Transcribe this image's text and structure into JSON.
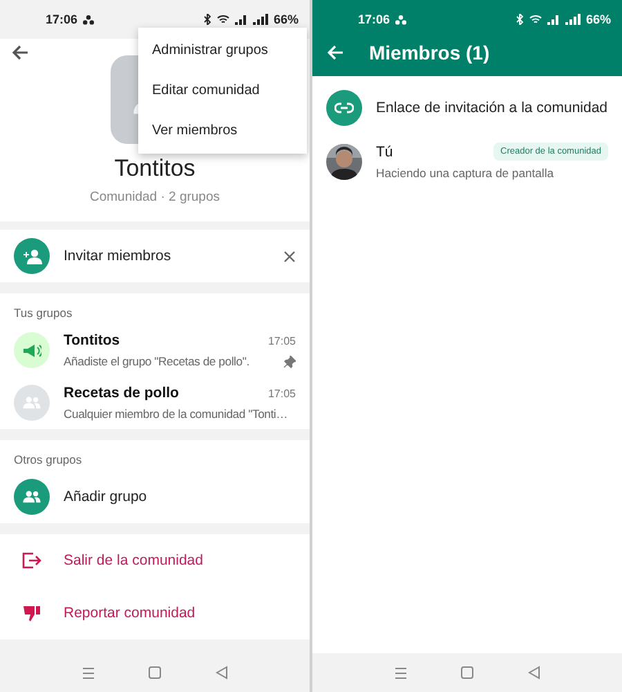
{
  "left": {
    "status_bar": {
      "time": "17:06",
      "battery": "66%"
    },
    "menu": [
      {
        "label": "Administrar grupos"
      },
      {
        "label": "Editar comunidad"
      },
      {
        "label": "Ver miembros"
      }
    ],
    "community": {
      "name": "Tontitos",
      "subtitle": "Comunidad · 2 grupos"
    },
    "invite": {
      "label": "Invitar miembros"
    },
    "sections": [
      {
        "title": "Tus grupos",
        "groups": [
          {
            "kind": "announcement",
            "name": "Tontitos",
            "time": "17:05",
            "message": "Añadiste el grupo \"Recetas de pollo\".",
            "pinned": true
          },
          {
            "kind": "group",
            "name": "Recetas de pollo",
            "time": "17:05",
            "message": "Cualquier miembro de la comunidad \"Tonti…",
            "pinned": false
          }
        ]
      },
      {
        "title": "Otros grupos",
        "groups": [
          {
            "kind": "add",
            "name": "Añadir grupo"
          }
        ]
      }
    ],
    "actions": [
      {
        "kind": "exit",
        "label": "Salir de la comunidad"
      },
      {
        "kind": "report",
        "label": "Reportar comunidad"
      }
    ]
  },
  "right": {
    "status_bar": {
      "time": "17:06",
      "battery": "66%"
    },
    "title": "Miembros (1)",
    "invite_link": {
      "label": "Enlace de invitación a la comunidad"
    },
    "members": [
      {
        "name": "Tú",
        "status": "Haciendo una captura de pantalla",
        "badge": "Creador de la comunidad"
      }
    ]
  }
}
